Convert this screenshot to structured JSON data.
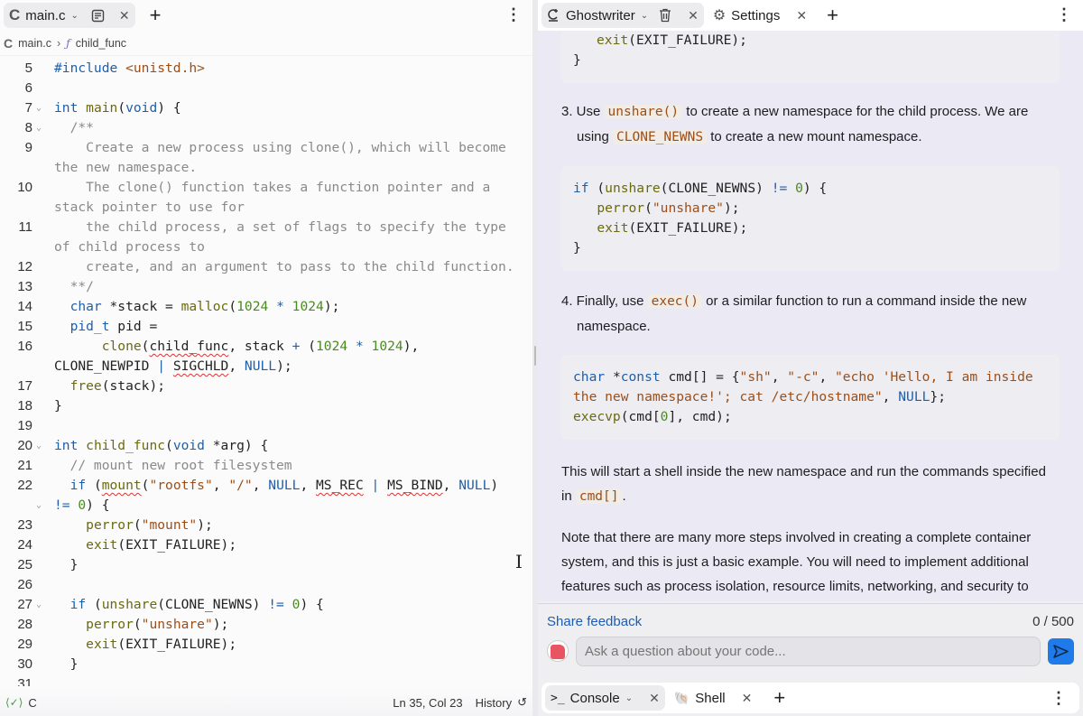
{
  "editor": {
    "tab": {
      "label": "main.c",
      "icon": "c-language-icon"
    },
    "breadcrumb": {
      "file": "main.c",
      "symbol": "child_func"
    },
    "lines": [
      {
        "n": "5",
        "html": "<span class='kw'>#include</span> <span class='st'>&lt;unistd.h&gt;</span>"
      },
      {
        "n": "6",
        "html": ""
      },
      {
        "n": "7",
        "fold": true,
        "html": "<span class='kw'>int</span> <span class='fn'>main</span>(<span class='kw'>void</span>) {"
      },
      {
        "n": "8",
        "fold": true,
        "html": "  <span class='cm'>/**</span>"
      },
      {
        "n": "9",
        "html": "<span class='cm'>    Create a new process using clone(), which will become</span>",
        "wrap": "<span class='cm'>the new namespace.</span>"
      },
      {
        "n": "10",
        "html": "<span class='cm'>    The clone() function takes a function pointer and a</span>",
        "wrap": "<span class='cm'>stack pointer to use for</span>"
      },
      {
        "n": "11",
        "html": "<span class='cm'>    the child process, a set of flags to specify the type</span>",
        "wrap": "<span class='cm'>of child process to</span>"
      },
      {
        "n": "12",
        "html": "<span class='cm'>    create, and an argument to pass to the child function.</span>"
      },
      {
        "n": "13",
        "html": "  <span class='cm'>**/</span>"
      },
      {
        "n": "14",
        "html": "  <span class='kw'>char</span> *stack = <span class='fn'>malloc</span>(<span class='nu'>1024</span> <span class='kw'>*</span> <span class='nu'>1024</span>);"
      },
      {
        "n": "15",
        "html": "  <span class='kw'>pid_t</span> pid ="
      },
      {
        "n": "16",
        "html": "      <span class='fn'>clone</span>(<span class='sq'>child_func</span>, stack <span class='kw'>+</span> (<span class='nu'>1024</span> <span class='kw'>*</span> <span class='nu'>1024</span>),",
        "wrap": "CLONE_NEWPID <span class='kw'>|</span> <span class='sq'>SIGCHLD</span>, <span class='cn'>NULL</span>);"
      },
      {
        "n": "17",
        "html": "  <span class='fn'>free</span>(stack);"
      },
      {
        "n": "18",
        "html": "}"
      },
      {
        "n": "19",
        "html": ""
      },
      {
        "n": "20",
        "fold": true,
        "html": "<span class='kw'>int</span> <span class='fn'>child_func</span>(<span class='kw'>void</span> *arg) {"
      },
      {
        "n": "21",
        "html": "  <span class='cm'>// mount new root filesystem</span>"
      },
      {
        "n": "22",
        "html": "  <span class='kw'>if</span> (<span class='fn sq'>mount</span>(<span class='st'>\"rootfs\"</span>, <span class='st'>\"/\"</span>, <span class='cn'>NULL</span>, <span class='sq'>MS_REC</span> <span class='kw'>|</span> <span class='sq'>MS_BIND</span>, <span class='cn'>NULL</span>)",
        "wrap": "<span class='kw'>!=</span> <span class='nu'>0</span>) {",
        "wrapfold": true
      },
      {
        "n": "23",
        "html": "    <span class='fn'>perror</span>(<span class='st'>\"mount\"</span>);"
      },
      {
        "n": "24",
        "html": "    <span class='fn'>exit</span>(EXIT_FAILURE);"
      },
      {
        "n": "25",
        "html": "  }"
      },
      {
        "n": "26",
        "html": ""
      },
      {
        "n": "27",
        "fold": true,
        "html": "  <span class='kw'>if</span> (<span class='fn'>unshare</span>(CLONE_NEWNS) <span class='kw'>!=</span> <span class='nu'>0</span>) {"
      },
      {
        "n": "28",
        "html": "    <span class='fn'>perror</span>(<span class='st'>\"unshare\"</span>);"
      },
      {
        "n": "29",
        "html": "    <span class='fn'>exit</span>(EXIT_FAILURE);"
      },
      {
        "n": "30",
        "html": "  }"
      },
      {
        "n": "31",
        "html": ""
      }
    ],
    "status": {
      "language": "C",
      "position": "Ln 35, Col 23",
      "history": "History"
    }
  },
  "assistant": {
    "tabs": [
      {
        "label": "Ghostwriter",
        "icon": "ghostwriter-icon"
      },
      {
        "label": "Settings",
        "icon": "gear-icon"
      }
    ],
    "messages": {
      "code_top": "<span style='padding-left:26px'></span><span class='fn'>exit</span>(EXIT_FAILURE);\n}",
      "step3": "3. Use <span class='ic-code'>unshare()</span> to create a new namespace for the child process. We are using <span class='ic-code'>CLONE_NEWNS</span> to create a new mount namespace.",
      "code3": "<span class='kw'>if</span> (<span class='fn'>unshare</span>(CLONE_NEWNS) <span class='kw'>!=</span> <span class='nu'>0</span>) {\n   <span class='fn'>perror</span>(<span class='st'>\"unshare\"</span>);\n   <span class='fn'>exit</span>(EXIT_FAILURE);\n}",
      "step4": "4. Finally, use <span class='ic-code'>exec()</span> or a similar function to run a command inside the new namespace.",
      "code4": "<span class='kw'>char</span> *<span class='kw'>const</span> cmd[] = {<span class='st'>\"sh\"</span>, <span class='st'>\"-c\"</span>, <span class='st'>\"echo 'Hello, I am inside the new namespace!'; cat /etc/hostname\"</span>, <span class='cn'>NULL</span>};\n<span class='fn'>execvp</span>(cmd[<span class='nu'>0</span>], cmd);",
      "para1": "This will start a shell inside the new namespace and run the commands specified in <span class='ic-code'>cmd[]</span>.",
      "para2": "Note that there are many more steps involved in creating a complete container system, and this is just a basic example. You will need to implement additional features such as process isolation, resource limits, networking, and security to create a full-fledged container system."
    },
    "feedback_label": "Share feedback",
    "char_count": "0 / 500",
    "input_placeholder": "Ask a question about your code..."
  },
  "bottom_tabs": [
    {
      "label": "Console",
      "icon": "terminal-icon"
    },
    {
      "label": "Shell",
      "icon": "shell-icon"
    }
  ]
}
